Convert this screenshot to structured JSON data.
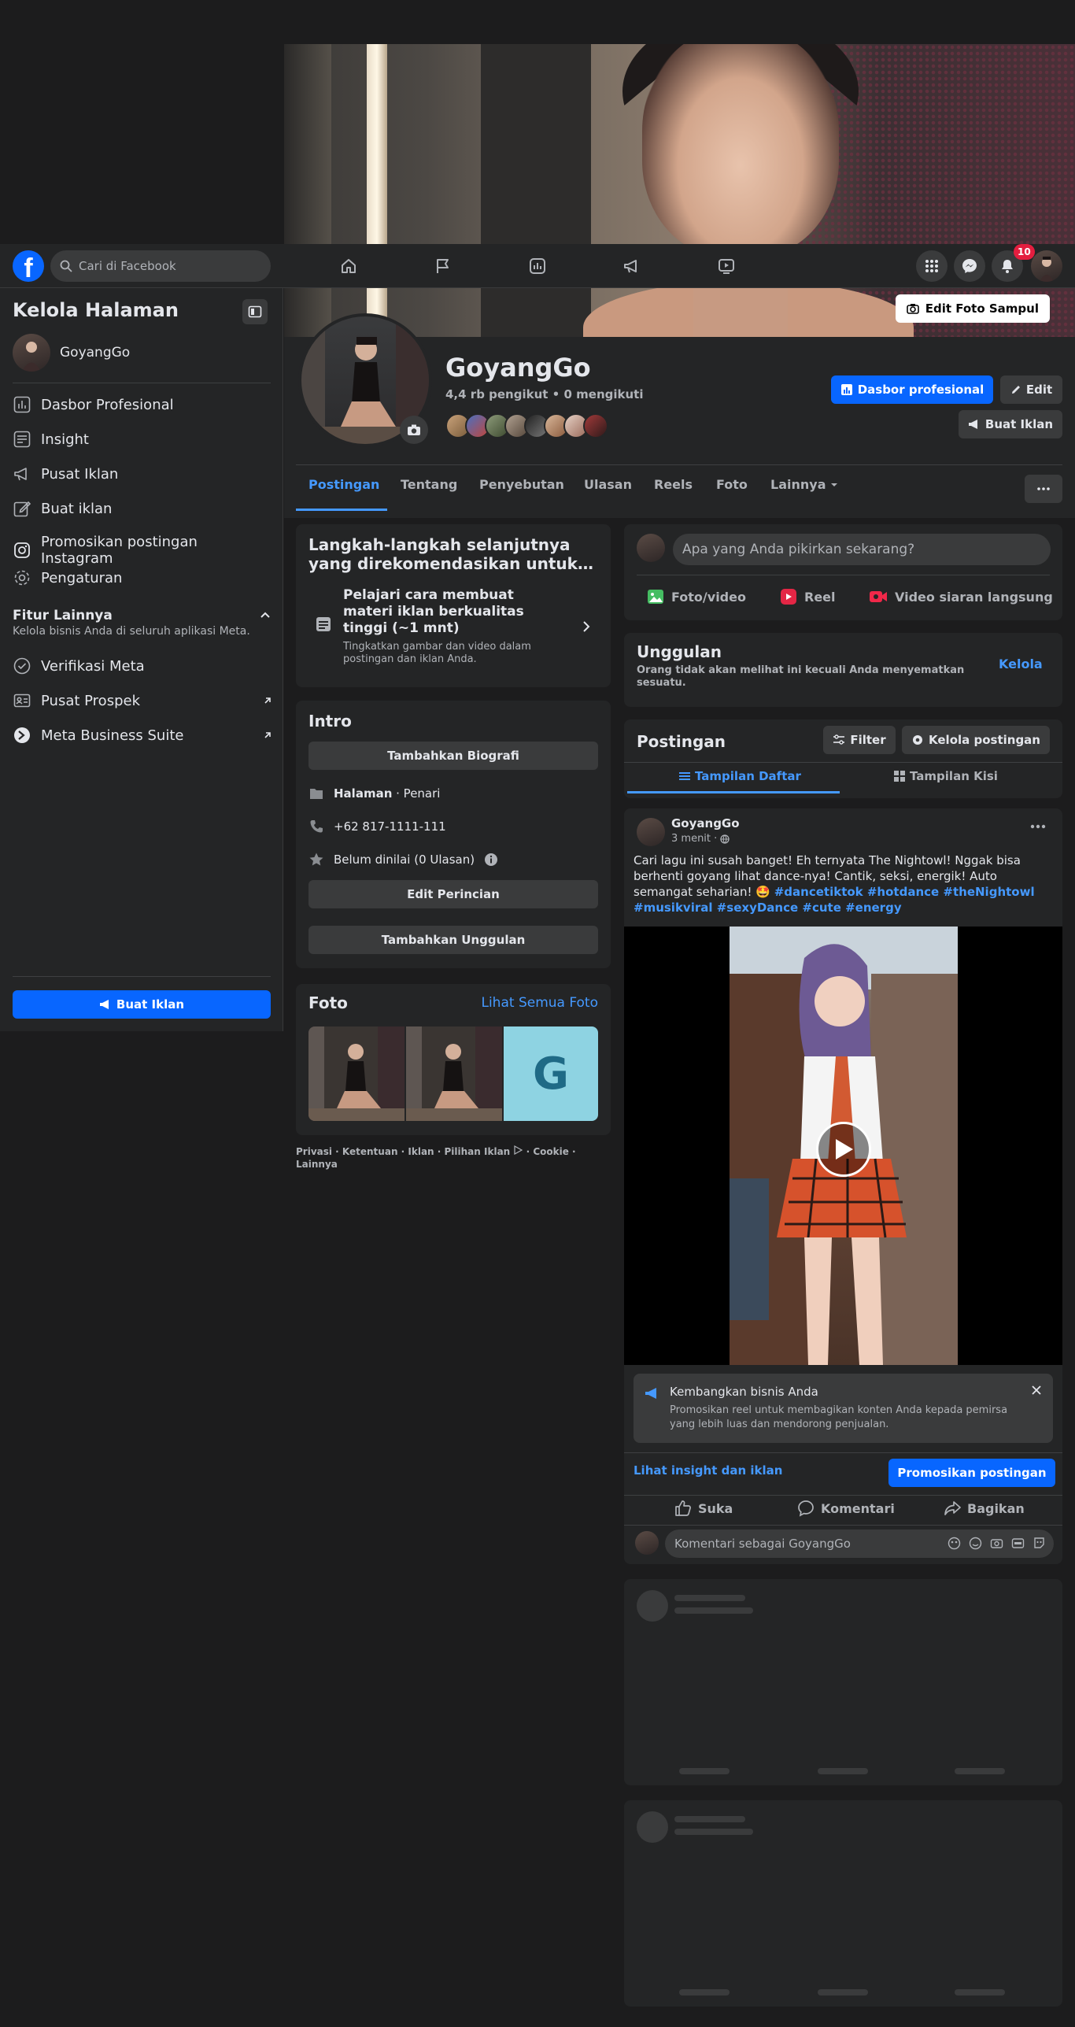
{
  "cover": {
    "edit_label": "Edit Foto Sampul"
  },
  "topnav": {
    "search_placeholder": "Cari di Facebook",
    "notifications_count": "10"
  },
  "sidebar": {
    "title": "Kelola Halaman",
    "page_name": "GoyangGo",
    "items": [
      {
        "label": "Dasbor Profesional",
        "icon": "chart-icon"
      },
      {
        "label": "Insight",
        "icon": "insight-icon"
      },
      {
        "label": "Pusat Iklan",
        "icon": "megaphone-icon"
      },
      {
        "label": "Buat iklan",
        "icon": "edit-icon"
      },
      {
        "label": "Promosikan postingan Instagram",
        "icon": "instagram-icon"
      },
      {
        "label": "Pengaturan",
        "icon": "gear-icon"
      }
    ],
    "more_features_title": "Fitur Lainnya",
    "more_features_subtitle": "Kelola bisnis Anda di seluruh aplikasi Meta.",
    "more_items": [
      {
        "label": "Verifikasi Meta",
        "icon": "verified-icon"
      },
      {
        "label": "Pusat Prospek",
        "icon": "leads-icon"
      },
      {
        "label": "Meta Business Suite",
        "icon": "business-suite-icon"
      }
    ],
    "create_ad_label": "Buat Iklan"
  },
  "profile": {
    "name": "GoyangGo",
    "stats": "4,4 rb pengikut • 0 mengikuti",
    "dashboard_label": "Dasbor profesional",
    "edit_label": "Edit",
    "create_ad_label": "Buat Iklan"
  },
  "tabs": [
    "Postingan",
    "Tentang",
    "Penyebutan",
    "Ulasan",
    "Reels",
    "Foto",
    "Lainnya"
  ],
  "recommend": {
    "title": "Langkah-langkah selanjutnya yang direkomendasikan untuk…",
    "item_title": "Pelajari cara membuat materi iklan berkualitas tinggi (~1 mnt)",
    "item_desc": "Tingkatkan gambar dan video dalam postingan dan iklan Anda."
  },
  "intro": {
    "title": "Intro",
    "add_bio": "Tambahkan Biografi",
    "category_bold": "Halaman",
    "category_rest": " · Penari",
    "phone": "+62 817-1111-111",
    "rating": "Belum dinilai (0 Ulasan)",
    "edit_details": "Edit Perincian",
    "add_featured": "Tambahkan Unggulan"
  },
  "photos": {
    "title": "Foto",
    "see_all": "Lihat Semua Foto",
    "letter": "G"
  },
  "footer": {
    "links": "Privasi · Ketentuan · Iklan · Pilihan Iklan",
    "links2": "· Cookie ·",
    "more": "Lainnya"
  },
  "composer": {
    "placeholder": "Apa yang Anda pikirkan sekarang?",
    "photo_video": "Foto/video",
    "reel": "Reel",
    "live": "Video siaran langsung"
  },
  "featured": {
    "title": "Unggulan",
    "subtitle": "Orang tidak akan melihat ini kecuali Anda menyematkan sesuatu.",
    "manage": "Kelola"
  },
  "posts_header": {
    "title": "Postingan",
    "filter": "Filter",
    "manage": "Kelola postingan",
    "list_view": "Tampilan Daftar",
    "grid_view": "Tampilan Kisi"
  },
  "post": {
    "author": "GoyangGo",
    "time": "3 menit ·",
    "text": "Cari lagu ini susah banget! Eh ternyata The Nightowl! Nggak bisa berhenti goyang lihat dance-nya! Cantik, seksi, energik! Auto semangat seharian! 🤩",
    "hashtags": "#dancetiktok #hotdance #theNightowl #musikviral #sexyDance #cute #energy",
    "promo_title": "Kembangkan bisnis Anda",
    "promo_desc": "Promosikan reel untuk membagikan konten Anda kepada pemirsa yang lebih luas dan mendorong penjualan.",
    "insight_link": "Lihat insight dan iklan",
    "promote_btn": "Promosikan postingan",
    "like": "Suka",
    "comment": "Komentari",
    "share": "Bagikan",
    "comment_placeholder": "Komentari sebagai GoyangGo"
  },
  "colors": {
    "accent": "#0866ff",
    "link": "#4599ff",
    "card": "#242526",
    "bg": "#1c1c1d"
  }
}
